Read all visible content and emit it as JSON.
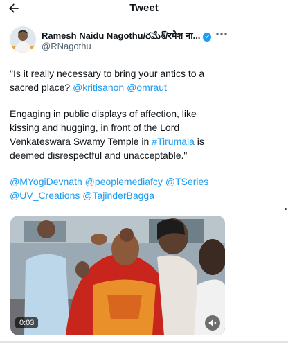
{
  "header": {
    "title": "Tweet",
    "back_icon": "arrow-left-icon"
  },
  "author": {
    "display_name": "Ramesh Naidu Nagothu/రమేశ్/रमेश ना...",
    "handle": "@RNagothu",
    "verified_color": "#1d9bf0",
    "more_icon": "more-horizontal-icon"
  },
  "tweet": {
    "p1": {
      "text": "\"Is it really necessary to bring your antics to a sacred place? ",
      "mention1": "@kritisanon",
      "mention2": "@omraut"
    },
    "p2": {
      "text_before": "Engaging in public displays of affection, like kissing and hugging, in front of the Lord Venkateswara Swamy Temple in ",
      "hashtag": "#Tirumala",
      "text_after": " is deemed disrespectful and unacceptable.\""
    },
    "p3": {
      "m1": "@MYogiDevnath",
      "m2": "@peoplemediafcy",
      "m3": "@TSeries",
      "m4": "@UV_Creations",
      "m5": "@TajinderBagga"
    },
    "link_color": "#1d9bf0"
  },
  "media": {
    "timestamp": "0:03",
    "mute_icon": "volume-muted-icon"
  }
}
